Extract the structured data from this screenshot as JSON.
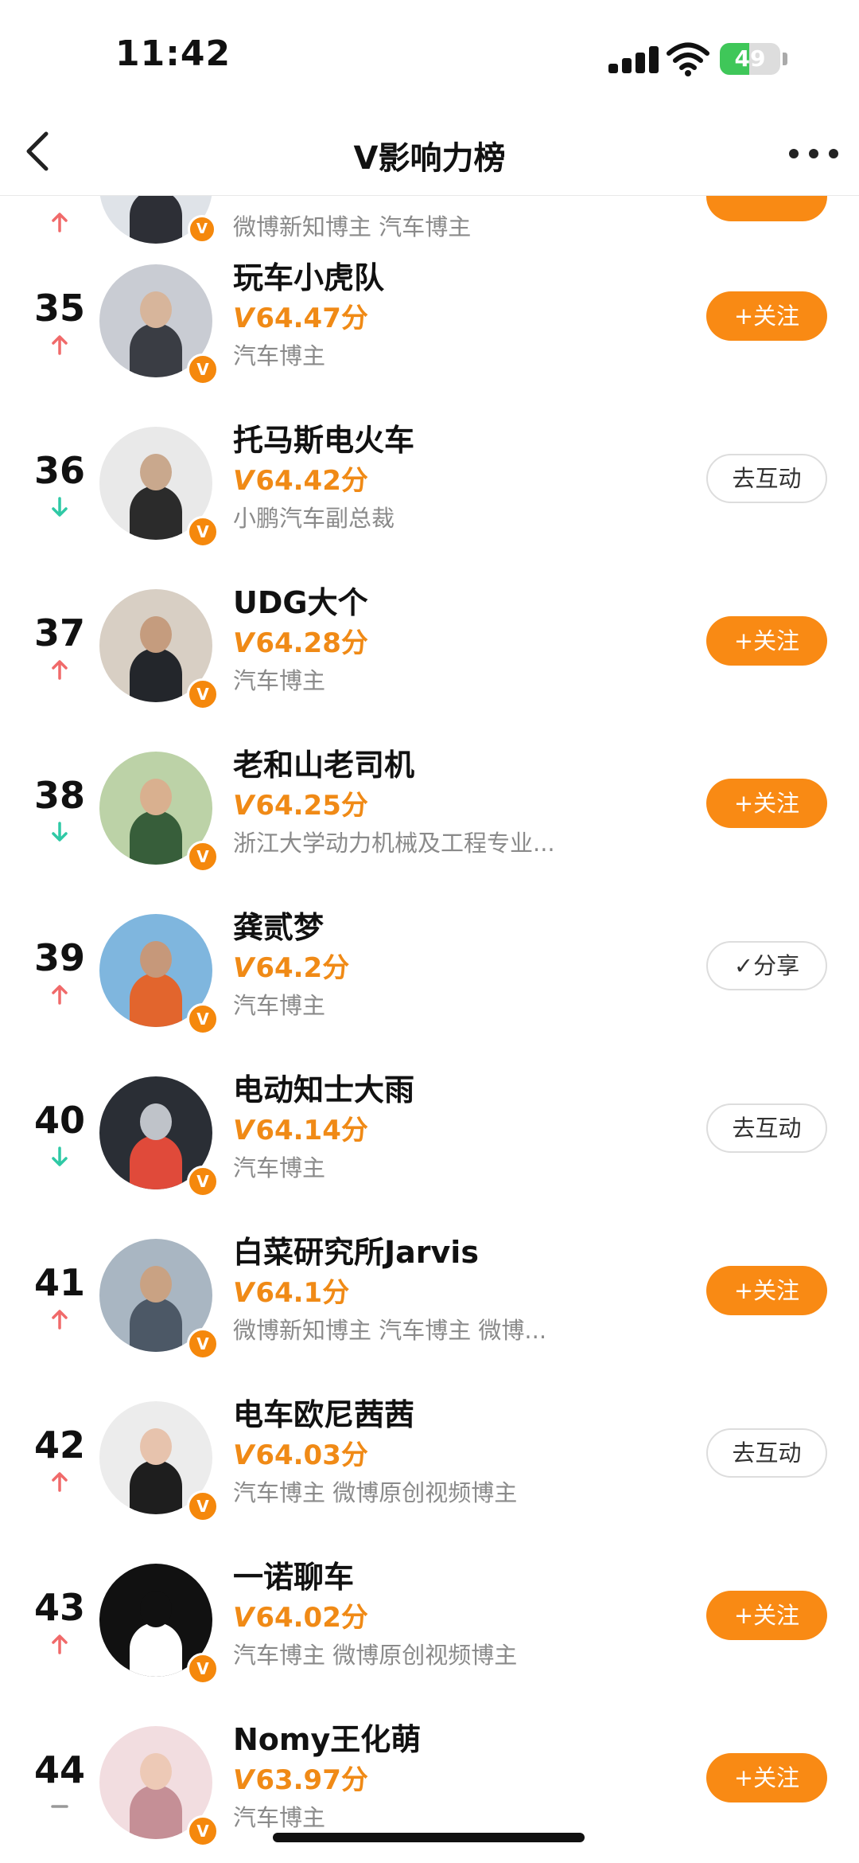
{
  "status_bar": {
    "time": "11:42",
    "battery": "49",
    "battery_level": 0.49
  },
  "nav": {
    "title": "V影响力榜"
  },
  "partial_row": {
    "desc": "微博新知博主 汽车博主"
  },
  "rows": [
    {
      "rank": "35",
      "trend": "up",
      "name": "玩车小虎队",
      "v": "V",
      "score": "64.47分",
      "desc": "汽车博主",
      "button": "+关注",
      "button_type": "follow",
      "badge": "V"
    },
    {
      "rank": "36",
      "trend": "down",
      "name": "托马斯电火车",
      "v": "V",
      "score": "64.42分",
      "desc": "小鹏汽车副总裁",
      "button": "去互动",
      "button_type": "plain",
      "badge": "V"
    },
    {
      "rank": "37",
      "trend": "up",
      "name": "UDG大个",
      "v": "V",
      "score": "64.28分",
      "desc": "汽车博主",
      "button": "+关注",
      "button_type": "follow",
      "badge": "V"
    },
    {
      "rank": "38",
      "trend": "down",
      "name": "老和山老司机",
      "v": "V",
      "score": "64.25分",
      "desc": "浙江大学动力机械及工程专业...",
      "button": "+关注",
      "button_type": "follow",
      "badge": "V"
    },
    {
      "rank": "39",
      "trend": "up",
      "name": "龚贰梦",
      "v": "V",
      "score": "64.2分",
      "desc": "汽车博主",
      "button": "✓分享",
      "button_type": "plain",
      "badge": "V"
    },
    {
      "rank": "40",
      "trend": "down",
      "name": "电动知士大雨",
      "v": "V",
      "score": "64.14分",
      "desc": "汽车博主",
      "button": "去互动",
      "button_type": "plain",
      "badge": "V"
    },
    {
      "rank": "41",
      "trend": "up",
      "name": "白菜研究所Jarvis",
      "v": "V",
      "score": "64.1分",
      "desc": "微博新知博主 汽车博主 微博...",
      "button": "+关注",
      "button_type": "follow",
      "badge": "V"
    },
    {
      "rank": "42",
      "trend": "up",
      "name": "电车欧尼茜茜",
      "v": "V",
      "score": "64.03分",
      "desc": "汽车博主 微博原创视频博主",
      "button": "去互动",
      "button_type": "plain",
      "badge": "V"
    },
    {
      "rank": "43",
      "trend": "up",
      "name": "一诺聊车",
      "v": "V",
      "score": "64.02分",
      "desc": "汽车博主 微博原创视频博主",
      "button": "+关注",
      "button_type": "follow",
      "badge": "V"
    },
    {
      "rank": "44",
      "trend": "same",
      "name": "Nomy王化萌",
      "v": "V",
      "score": "63.97分",
      "desc": "汽车博主",
      "button": "+关注",
      "button_type": "follow",
      "badge": "V"
    }
  ],
  "colors": {
    "accent": "#f98a14",
    "up": "#f06a6a",
    "down": "#2fc9a5",
    "gray_text": "#8a8a8a"
  },
  "icons": {
    "back": "chevron-left-icon",
    "more": "more-dots-icon",
    "verified": "verified-v-icon"
  }
}
